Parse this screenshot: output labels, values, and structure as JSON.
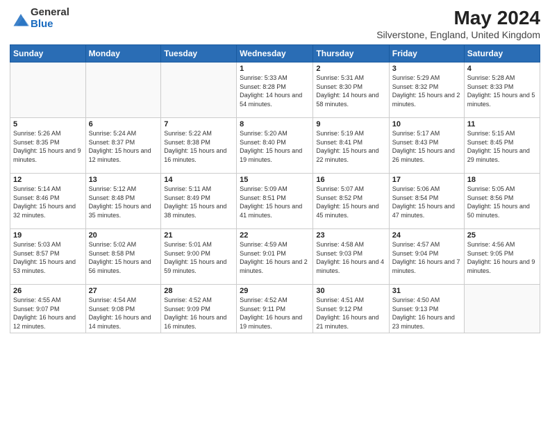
{
  "logo": {
    "general": "General",
    "blue": "Blue"
  },
  "header": {
    "month_year": "May 2024",
    "location": "Silverstone, England, United Kingdom"
  },
  "weekdays": [
    "Sunday",
    "Monday",
    "Tuesday",
    "Wednesday",
    "Thursday",
    "Friday",
    "Saturday"
  ],
  "weeks": [
    [
      {
        "day": "",
        "sunrise": "",
        "sunset": "",
        "daylight": ""
      },
      {
        "day": "",
        "sunrise": "",
        "sunset": "",
        "daylight": ""
      },
      {
        "day": "",
        "sunrise": "",
        "sunset": "",
        "daylight": ""
      },
      {
        "day": "1",
        "sunrise": "Sunrise: 5:33 AM",
        "sunset": "Sunset: 8:28 PM",
        "daylight": "Daylight: 14 hours and 54 minutes."
      },
      {
        "day": "2",
        "sunrise": "Sunrise: 5:31 AM",
        "sunset": "Sunset: 8:30 PM",
        "daylight": "Daylight: 14 hours and 58 minutes."
      },
      {
        "day": "3",
        "sunrise": "Sunrise: 5:29 AM",
        "sunset": "Sunset: 8:32 PM",
        "daylight": "Daylight: 15 hours and 2 minutes."
      },
      {
        "day": "4",
        "sunrise": "Sunrise: 5:28 AM",
        "sunset": "Sunset: 8:33 PM",
        "daylight": "Daylight: 15 hours and 5 minutes."
      }
    ],
    [
      {
        "day": "5",
        "sunrise": "Sunrise: 5:26 AM",
        "sunset": "Sunset: 8:35 PM",
        "daylight": "Daylight: 15 hours and 9 minutes."
      },
      {
        "day": "6",
        "sunrise": "Sunrise: 5:24 AM",
        "sunset": "Sunset: 8:37 PM",
        "daylight": "Daylight: 15 hours and 12 minutes."
      },
      {
        "day": "7",
        "sunrise": "Sunrise: 5:22 AM",
        "sunset": "Sunset: 8:38 PM",
        "daylight": "Daylight: 15 hours and 16 minutes."
      },
      {
        "day": "8",
        "sunrise": "Sunrise: 5:20 AM",
        "sunset": "Sunset: 8:40 PM",
        "daylight": "Daylight: 15 hours and 19 minutes."
      },
      {
        "day": "9",
        "sunrise": "Sunrise: 5:19 AM",
        "sunset": "Sunset: 8:41 PM",
        "daylight": "Daylight: 15 hours and 22 minutes."
      },
      {
        "day": "10",
        "sunrise": "Sunrise: 5:17 AM",
        "sunset": "Sunset: 8:43 PM",
        "daylight": "Daylight: 15 hours and 26 minutes."
      },
      {
        "day": "11",
        "sunrise": "Sunrise: 5:15 AM",
        "sunset": "Sunset: 8:45 PM",
        "daylight": "Daylight: 15 hours and 29 minutes."
      }
    ],
    [
      {
        "day": "12",
        "sunrise": "Sunrise: 5:14 AM",
        "sunset": "Sunset: 8:46 PM",
        "daylight": "Daylight: 15 hours and 32 minutes."
      },
      {
        "day": "13",
        "sunrise": "Sunrise: 5:12 AM",
        "sunset": "Sunset: 8:48 PM",
        "daylight": "Daylight: 15 hours and 35 minutes."
      },
      {
        "day": "14",
        "sunrise": "Sunrise: 5:11 AM",
        "sunset": "Sunset: 8:49 PM",
        "daylight": "Daylight: 15 hours and 38 minutes."
      },
      {
        "day": "15",
        "sunrise": "Sunrise: 5:09 AM",
        "sunset": "Sunset: 8:51 PM",
        "daylight": "Daylight: 15 hours and 41 minutes."
      },
      {
        "day": "16",
        "sunrise": "Sunrise: 5:07 AM",
        "sunset": "Sunset: 8:52 PM",
        "daylight": "Daylight: 15 hours and 45 minutes."
      },
      {
        "day": "17",
        "sunrise": "Sunrise: 5:06 AM",
        "sunset": "Sunset: 8:54 PM",
        "daylight": "Daylight: 15 hours and 47 minutes."
      },
      {
        "day": "18",
        "sunrise": "Sunrise: 5:05 AM",
        "sunset": "Sunset: 8:56 PM",
        "daylight": "Daylight: 15 hours and 50 minutes."
      }
    ],
    [
      {
        "day": "19",
        "sunrise": "Sunrise: 5:03 AM",
        "sunset": "Sunset: 8:57 PM",
        "daylight": "Daylight: 15 hours and 53 minutes."
      },
      {
        "day": "20",
        "sunrise": "Sunrise: 5:02 AM",
        "sunset": "Sunset: 8:58 PM",
        "daylight": "Daylight: 15 hours and 56 minutes."
      },
      {
        "day": "21",
        "sunrise": "Sunrise: 5:01 AM",
        "sunset": "Sunset: 9:00 PM",
        "daylight": "Daylight: 15 hours and 59 minutes."
      },
      {
        "day": "22",
        "sunrise": "Sunrise: 4:59 AM",
        "sunset": "Sunset: 9:01 PM",
        "daylight": "Daylight: 16 hours and 2 minutes."
      },
      {
        "day": "23",
        "sunrise": "Sunrise: 4:58 AM",
        "sunset": "Sunset: 9:03 PM",
        "daylight": "Daylight: 16 hours and 4 minutes."
      },
      {
        "day": "24",
        "sunrise": "Sunrise: 4:57 AM",
        "sunset": "Sunset: 9:04 PM",
        "daylight": "Daylight: 16 hours and 7 minutes."
      },
      {
        "day": "25",
        "sunrise": "Sunrise: 4:56 AM",
        "sunset": "Sunset: 9:05 PM",
        "daylight": "Daylight: 16 hours and 9 minutes."
      }
    ],
    [
      {
        "day": "26",
        "sunrise": "Sunrise: 4:55 AM",
        "sunset": "Sunset: 9:07 PM",
        "daylight": "Daylight: 16 hours and 12 minutes."
      },
      {
        "day": "27",
        "sunrise": "Sunrise: 4:54 AM",
        "sunset": "Sunset: 9:08 PM",
        "daylight": "Daylight: 16 hours and 14 minutes."
      },
      {
        "day": "28",
        "sunrise": "Sunrise: 4:52 AM",
        "sunset": "Sunset: 9:09 PM",
        "daylight": "Daylight: 16 hours and 16 minutes."
      },
      {
        "day": "29",
        "sunrise": "Sunrise: 4:52 AM",
        "sunset": "Sunset: 9:11 PM",
        "daylight": "Daylight: 16 hours and 19 minutes."
      },
      {
        "day": "30",
        "sunrise": "Sunrise: 4:51 AM",
        "sunset": "Sunset: 9:12 PM",
        "daylight": "Daylight: 16 hours and 21 minutes."
      },
      {
        "day": "31",
        "sunrise": "Sunrise: 4:50 AM",
        "sunset": "Sunset: 9:13 PM",
        "daylight": "Daylight: 16 hours and 23 minutes."
      },
      {
        "day": "",
        "sunrise": "",
        "sunset": "",
        "daylight": ""
      }
    ]
  ]
}
